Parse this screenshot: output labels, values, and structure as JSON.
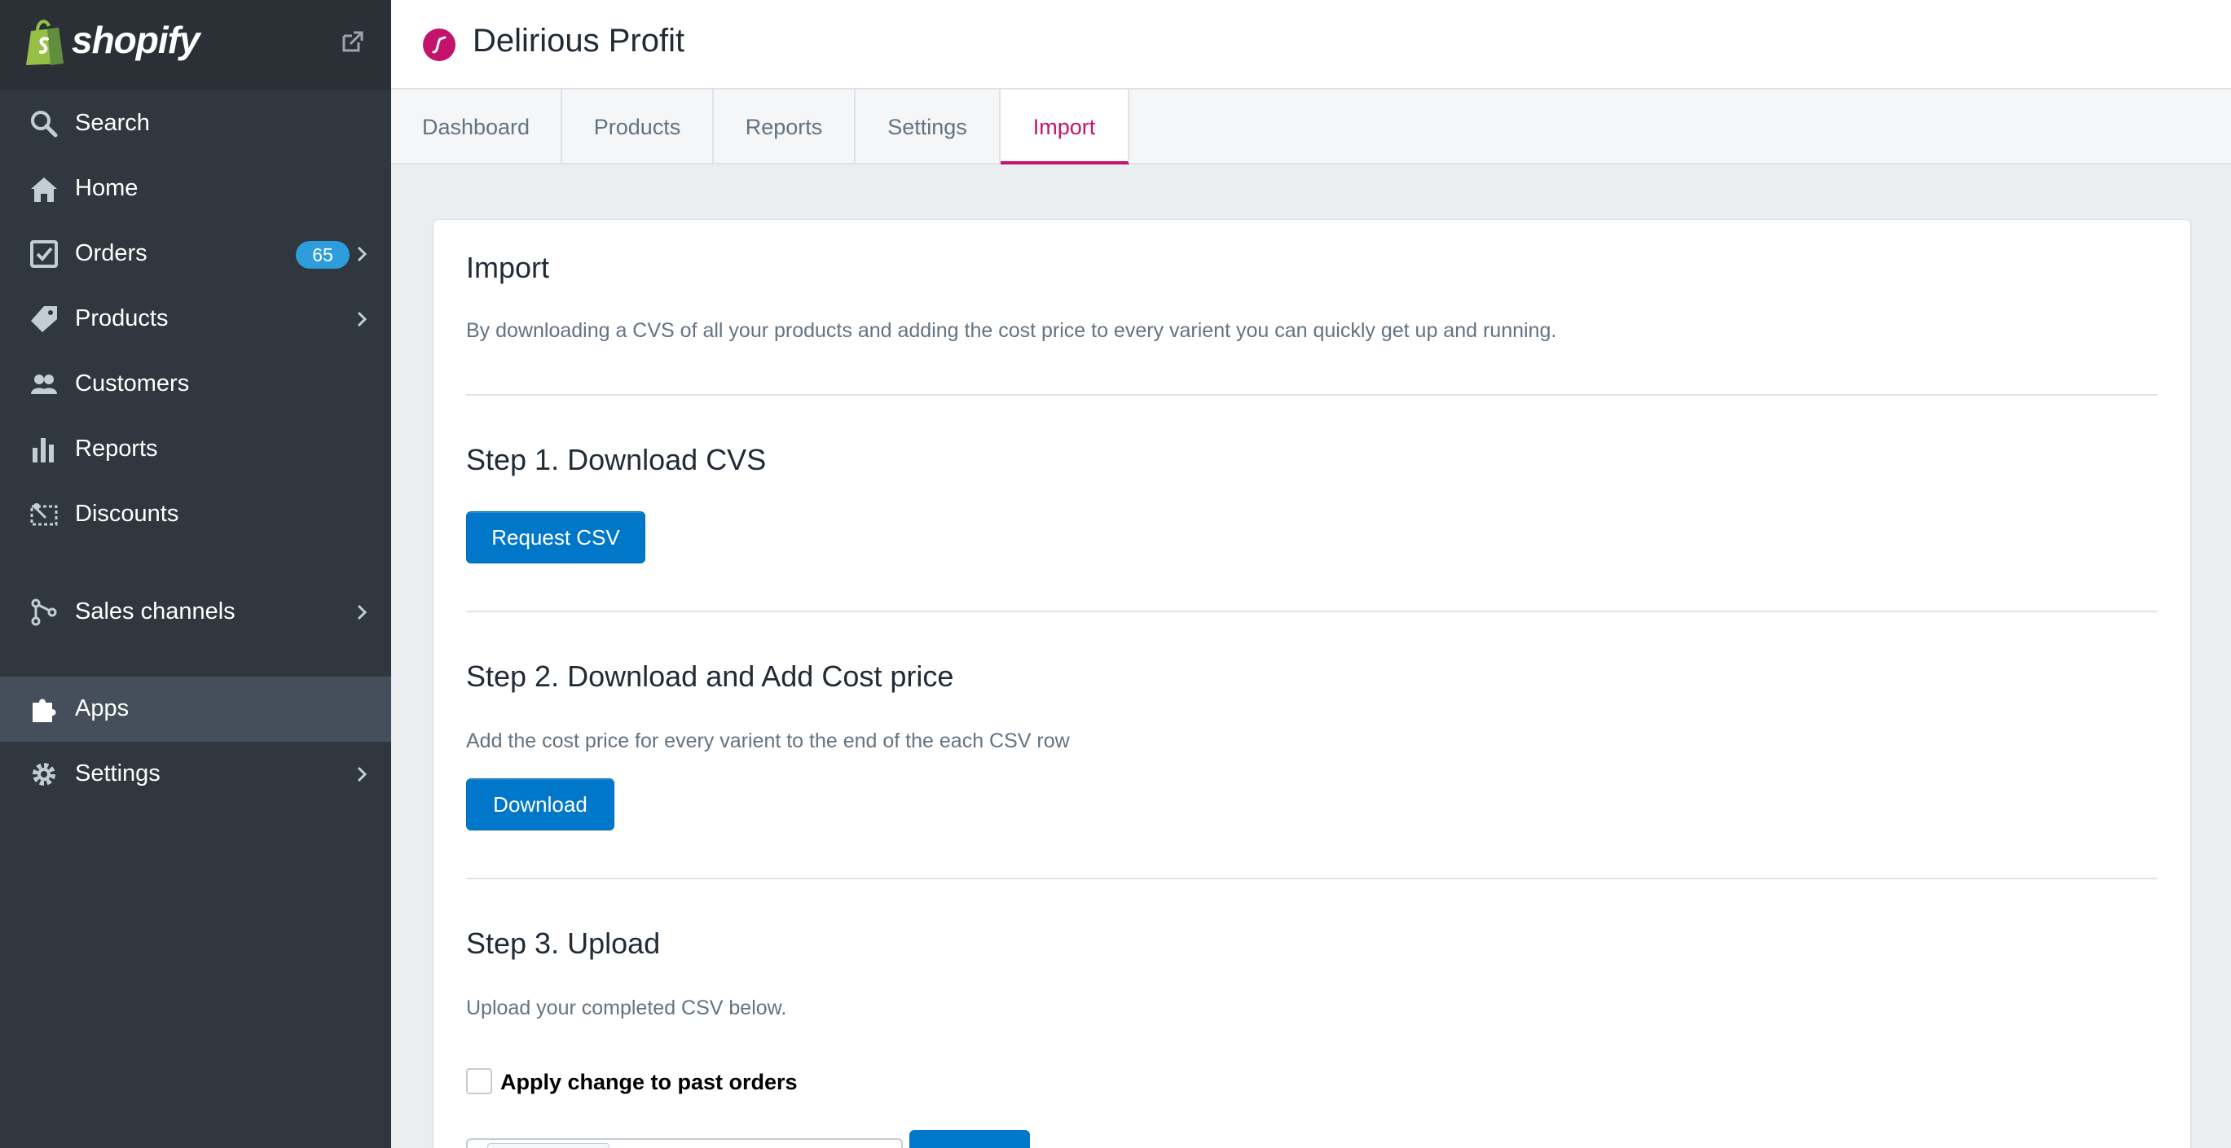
{
  "sidebar": {
    "brand": "shopify",
    "items": [
      {
        "label": "Search",
        "icon": "search-icon"
      },
      {
        "label": "Home",
        "icon": "home-icon"
      },
      {
        "label": "Orders",
        "icon": "orders-icon",
        "badge": "65"
      },
      {
        "label": "Products",
        "icon": "tag-icon"
      },
      {
        "label": "Customers",
        "icon": "customers-icon"
      },
      {
        "label": "Reports",
        "icon": "bar-chart-icon"
      },
      {
        "label": "Discounts",
        "icon": "discount-icon"
      },
      {
        "label": "Sales channels",
        "icon": "channels-icon"
      },
      {
        "label": "Apps",
        "icon": "puzzle-icon"
      },
      {
        "label": "Settings",
        "icon": "gear-icon"
      }
    ]
  },
  "header": {
    "app_title": "Delirious Profit"
  },
  "tabs": [
    {
      "label": "Dashboard"
    },
    {
      "label": "Products"
    },
    {
      "label": "Reports"
    },
    {
      "label": "Settings"
    },
    {
      "label": "Import"
    }
  ],
  "main": {
    "title": "Import",
    "description": "By downloading a CVS of all your products and adding the cost price to every varient you can quickly get up and running.",
    "step1": {
      "title": "Step 1. Download CVS",
      "button": "Request CSV"
    },
    "step2": {
      "title": "Step 2. Download and Add Cost price",
      "description": "Add the cost price for every varient to the end of the each CSV row",
      "button": "Download"
    },
    "step3": {
      "title": "Step 3. Upload",
      "description": "Upload your completed CSV below.",
      "checkbox_label": "Apply change to past orders"
    }
  },
  "colors": {
    "sidebar": "#30373e",
    "active_tab": "#c3136d",
    "primary_button": "#0077c8",
    "badge": "#2e9ddb"
  }
}
